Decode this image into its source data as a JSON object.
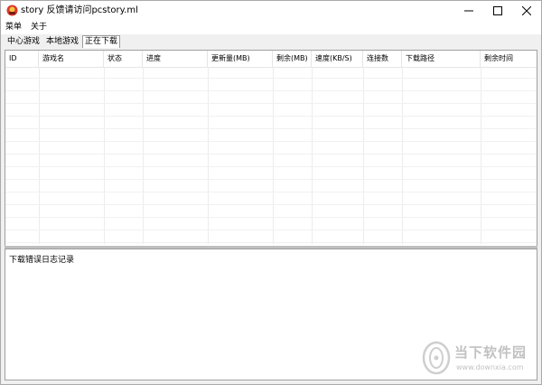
{
  "window": {
    "title": "story 反馈请访问pcstory.ml"
  },
  "menu": [
    {
      "label": "菜单"
    },
    {
      "label": "关于"
    }
  ],
  "tabs": [
    {
      "label": "中心游戏"
    },
    {
      "label": "本地游戏"
    },
    {
      "label": "正在下载",
      "active": true
    }
  ],
  "table": {
    "columns": [
      "ID",
      "游戏名",
      "状态",
      "进度",
      "更新量(MB)",
      "剩余(MB)",
      "速度(KB/S)",
      "连接数",
      "下载路径",
      "剩余时间"
    ],
    "rows": []
  },
  "log": {
    "title": "下载错误日志记录"
  },
  "watermark": {
    "main": "当下软件园",
    "sub": "www.downxia.com"
  },
  "icons": {
    "app": "app-logo-icon",
    "minimize": "minimize-icon",
    "maximize": "maximize-icon",
    "close": "close-icon",
    "watermark": "watermark-logo-icon"
  },
  "colors": {
    "window_bg": "#f0f0f0",
    "content_bg": "#ffffff",
    "grid_line": "#ececec",
    "border": "#a0a0a0",
    "app_icon_red": "#c0392b"
  }
}
